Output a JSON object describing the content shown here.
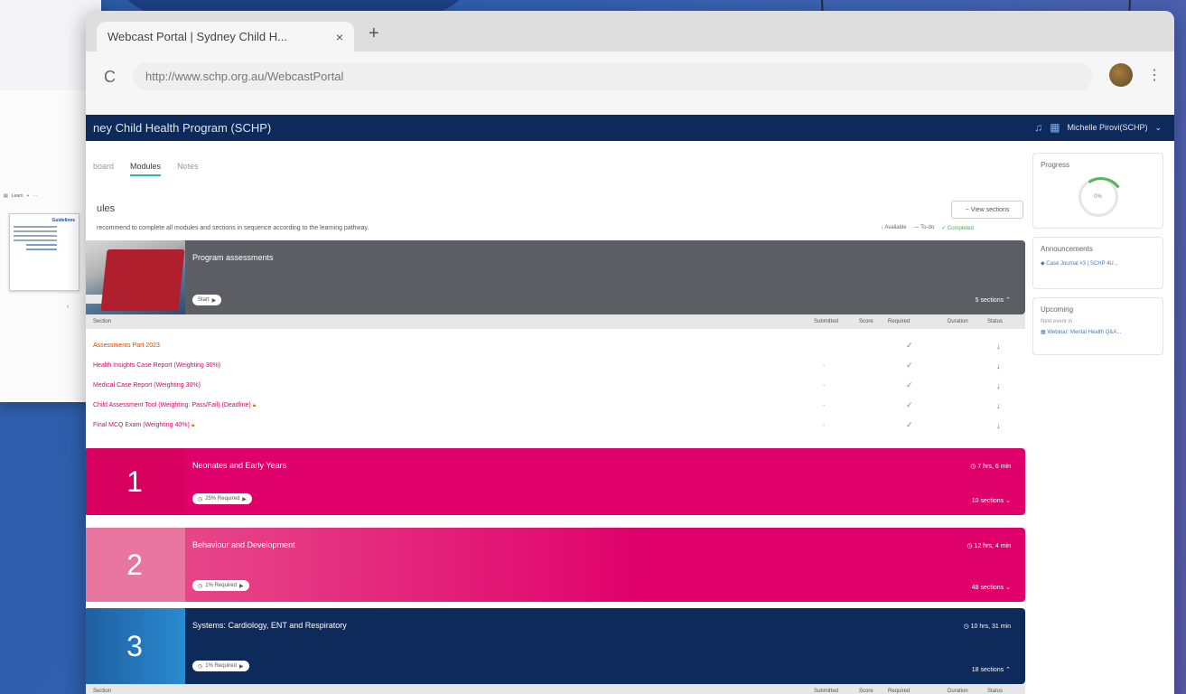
{
  "browser": {
    "tab_title": "Webcast Portal | Sydney Child H...",
    "tab_close": "×",
    "new_tab": "+",
    "reload": "C",
    "url": "http://www.schp.org.au/WebcastPortal",
    "menu": "⋮"
  },
  "background_window": {
    "toolbar_text": "Learn",
    "page_heading": "Guidelines"
  },
  "site": {
    "title": "ney Child Health Program (SCHP)",
    "user": "Michelle Pirovi(SCHP)",
    "tabs": [
      "board",
      "Modules",
      "Notes"
    ],
    "active_tab": 1,
    "section_title": "ules",
    "section_note": "recommend to complete all modules and sections in sequence according to the learning pathway.",
    "view_button": "View sections",
    "legend": {
      "available": "Available",
      "to_do": "To-do",
      "completed": "Completed"
    }
  },
  "table_headers": {
    "section": "Section",
    "submitted": "Submitted",
    "score": "Score",
    "required": "Required",
    "duration": "Duration",
    "status": "Status"
  },
  "modules": [
    {
      "number": "",
      "name": "Program assessments",
      "pill": "Start",
      "time": "",
      "sections": "5 sections",
      "color": "#5c5e63"
    },
    {
      "number": "1",
      "name": "Neonates and Early Years",
      "pill": "25% Required",
      "time": "7 hrs, 6 min",
      "sections": "10 sections",
      "color": "#e0006b"
    },
    {
      "number": "2",
      "name": "Behaviour and Development",
      "pill": "1% Required",
      "time": "12 hrs, 4 min",
      "sections": "48 sections",
      "color": "#e0006b"
    },
    {
      "number": "3",
      "name": "Systems: Cardiology, ENT and Respiratory",
      "pill": "1% Required",
      "time": "10 hrs, 31 min",
      "sections": "18 sections",
      "color": "#0e2a5a"
    }
  ],
  "assessment_rows": [
    {
      "name": "Assessments Part 2023",
      "submitted": "",
      "required": "✓",
      "status": "↓"
    },
    {
      "name": "Health Insights Case Report (Weighting 30%)",
      "submitted": "-",
      "required": "✓",
      "status": "↓"
    },
    {
      "name": "Medical Case Report (Weighting 30%)",
      "submitted": "-",
      "required": "✓",
      "status": "↓"
    },
    {
      "name": "Child Assessment Tool (Weighting: Pass/Fail) (Deadline)",
      "submitted": "-",
      "required": "✓",
      "status": "↓"
    },
    {
      "name": "Final MCQ Exam (Weighting 40%)",
      "submitted": "-",
      "required": "✓",
      "status": "↓"
    }
  ],
  "sidebar": {
    "progress_label": "Progress",
    "progress_value": "0%",
    "progress_fraction": 0.05,
    "announcements_label": "Announcements",
    "announcement_item": "Case Journal #3 | SCHP 4U...",
    "upcoming_label": "Upcoming",
    "upcoming_sub": "Next event in",
    "upcoming_item": "Webinar: Mental Health Q&A..."
  }
}
